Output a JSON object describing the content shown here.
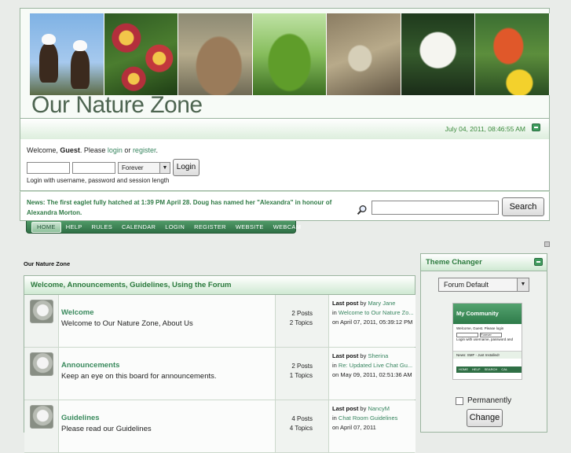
{
  "header": {
    "site_title": "Our Nature Zone",
    "photos": [
      "eagles",
      "primroses",
      "rabbit",
      "frog",
      "fish",
      "lily",
      "butterfly"
    ]
  },
  "datebar": {
    "date": "July 04, 2011, 08:46:55 AM"
  },
  "user_panel": {
    "welcome_prefix": "Welcome, ",
    "guest": "Guest",
    "please": ". Please ",
    "login_link": "login",
    "or": " or ",
    "register_link": "register",
    "period": ".",
    "session_option": "Forever",
    "login_button": "Login",
    "hint": "Login with username, password and session length"
  },
  "news": {
    "text": "News: The first eaglet fully hatched at 1:39 PM April 28. Doug has named her \"Alexandra\" in honour of Alexandra Morton.",
    "search_button": "Search"
  },
  "nav": {
    "items": [
      "HOME",
      "HELP",
      "RULES",
      "CALENDAR",
      "LOGIN",
      "REGISTER",
      "WEBSITE",
      "WEBCAM"
    ]
  },
  "linktree": "Our Nature Zone",
  "category": {
    "title": "Welcome, Announcements, Guidelines, Using the Forum",
    "boards": [
      {
        "name": "Welcome",
        "desc": "Welcome to Our Nature Zone, About Us",
        "posts": "2 Posts",
        "topics": "2 Topics",
        "last_by": "Mary Jane",
        "last_in": "Welcome to Our Nature Zo...",
        "last_date": "on April 07, 2011, 05:39:12 PM"
      },
      {
        "name": "Announcements",
        "desc": "Keep an eye on this board for announcements.",
        "posts": "2 Posts",
        "topics": "1 Topics",
        "last_by": "Sherina",
        "last_in": "Re: Updated Live Chat Gu...",
        "last_date": "on May 09, 2011, 02:51:36 AM"
      },
      {
        "name": "Guidelines",
        "desc": "Please read our Guidelines",
        "posts": "4 Posts",
        "topics": "4 Topics",
        "last_by": "NancyM",
        "last_in": "Chat Room Guidelines",
        "last_date": "on April 07, 2011"
      }
    ],
    "last_post_label": "Last post",
    "by": " by ",
    "in": "in "
  },
  "theme_changer": {
    "title": "Theme Changer",
    "selected": "Forum Default",
    "preview": {
      "community": "My Community",
      "welcome": "Welcome, Guest. Please login",
      "hint": "Login with username, password and",
      "session": "Forever",
      "news": "News: SMF - Just Installed!",
      "nav": "HOME HELP SEARCH CAL"
    },
    "permanently": "Permanently",
    "change_button": "Change"
  }
}
